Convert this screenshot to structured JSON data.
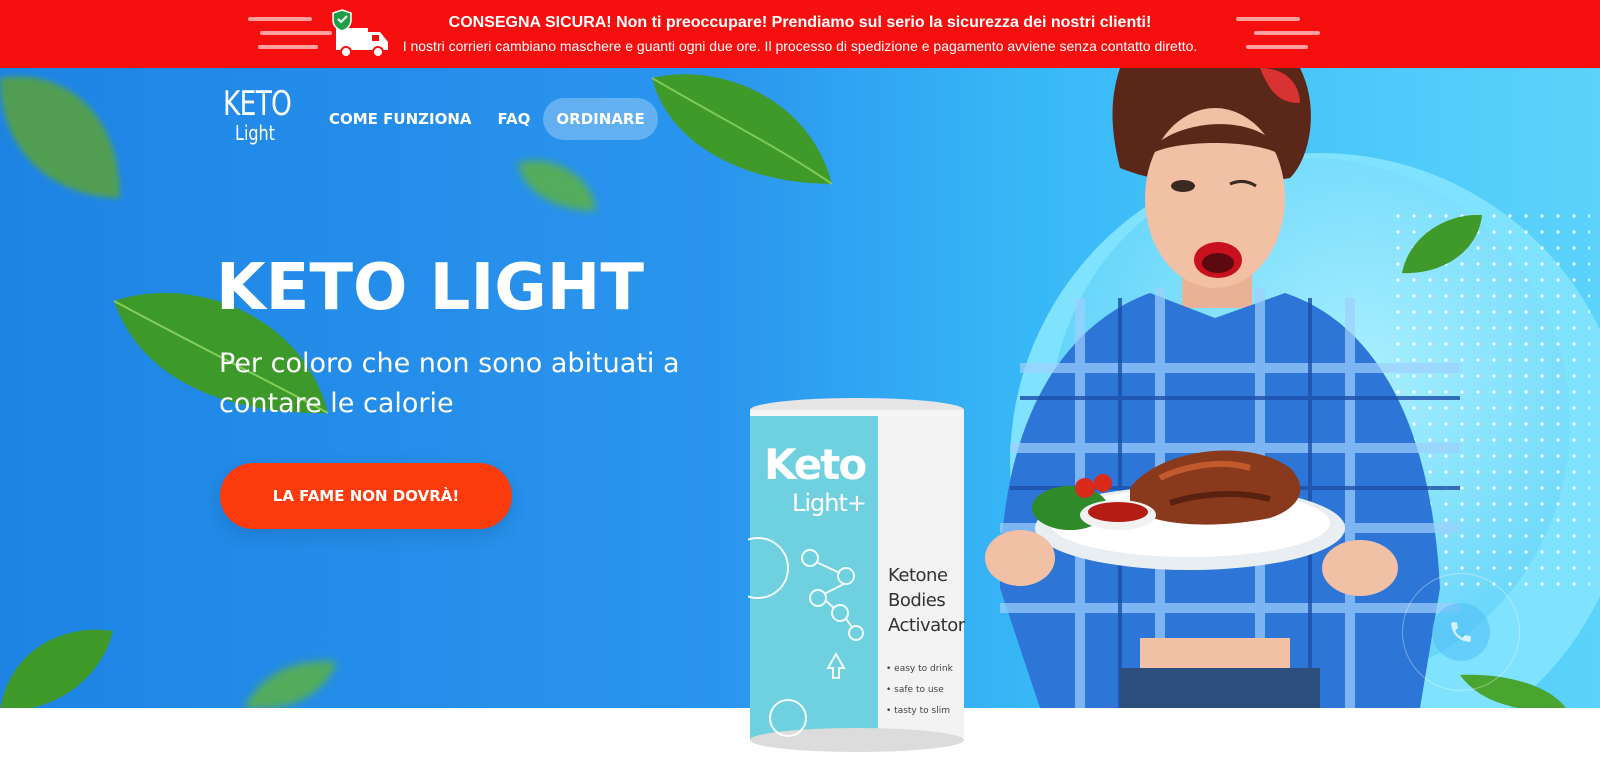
{
  "topbar": {
    "headline": "CONSEGNA SICURA! Non ti preoccupare! Prendiamo sul serio la sicurezza dei nostri clienti!",
    "subline": "I nostri corrieri cambiano maschere e guanti ogni due ore. Il processo di spedizione e pagamento avviene senza contatto diretto.",
    "icon": "delivery-truck-shield-icon"
  },
  "logo": {
    "line1": "KETO",
    "line2": "Light"
  },
  "nav": {
    "items": [
      {
        "label": "COME FUNZIONA"
      },
      {
        "label": "FAQ"
      },
      {
        "label": "ORDINARE",
        "active": true
      }
    ]
  },
  "hero": {
    "title": "KETO LIGHT",
    "subtitle": "Per coloro che non sono abituati a contare le calorie",
    "cta_label": "LA FAME NON DOVRÀ!"
  },
  "product": {
    "brand": "Keto",
    "brand_sub": "Light+",
    "descriptor_lines": [
      "Ketone",
      "Bodies",
      "Activator"
    ],
    "features": [
      "easy to drink",
      "safe to use",
      "tasty to slim"
    ]
  },
  "phone_button": {
    "icon": "phone-icon"
  },
  "colors": {
    "topbar": "#f50f0f",
    "hero_blue": "#1e84e4",
    "cta": "#fb3b0b",
    "can_teal": "#6fd0e0"
  }
}
